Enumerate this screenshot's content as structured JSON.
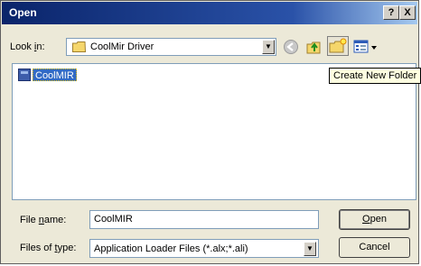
{
  "window": {
    "title": "Open",
    "help_label": "?",
    "close_label": "X"
  },
  "lookin": {
    "label_prefix": "Look ",
    "label_accel": "i",
    "label_suffix": "n:",
    "value": "CoolMir Driver",
    "folder_icon": "folder-icon",
    "dropdown_icon": "chevron-down-icon"
  },
  "toolbar": {
    "icons": [
      "back-icon",
      "up-folder-icon",
      "create-new-folder-icon",
      "views-menu-icon"
    ],
    "tooltip": "Create New Folder"
  },
  "files": [
    {
      "name": "CoolMIR",
      "icon": "file-icon",
      "selected": true
    }
  ],
  "filename": {
    "label_prefix": "File ",
    "label_accel": "n",
    "label_suffix": "ame:",
    "value": "CoolMIR"
  },
  "filetype": {
    "label_prefix": "Files of ",
    "label_accel": "t",
    "label_suffix": "ype:",
    "value": "Application Loader Files (*.alx;*.ali)"
  },
  "buttons": {
    "open_accel": "O",
    "open_rest": "pen",
    "cancel": "Cancel"
  }
}
